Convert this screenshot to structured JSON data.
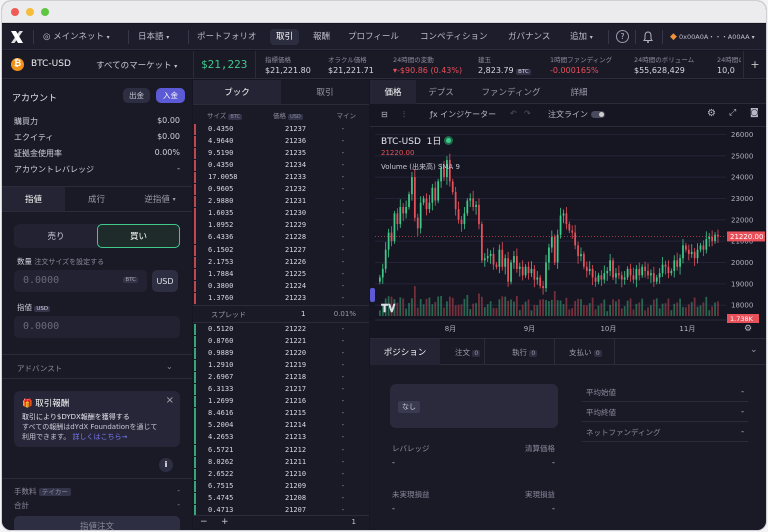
{
  "nav": {
    "network": "メインネット",
    "language": "日本語",
    "items": [
      "ポートフォリオ",
      "取引",
      "報酬",
      "プロフィール",
      "コンペティション",
      "ガバナンス",
      "追加"
    ],
    "address": "0x00A0A・・・A00AA"
  },
  "market": {
    "symbol": "BTC-USD",
    "all_markets": "すべてのマーケット",
    "price": "$21,223",
    "stats": [
      {
        "label": "指標価格",
        "value": "$21,221.80"
      },
      {
        "label": "オラクル価格",
        "value": "$21,221.71"
      },
      {
        "label": "24時間の変動",
        "value": "-$90.86 (0.43%)"
      },
      {
        "label": "建玉",
        "value": "2,823.79",
        "unit": "BTC"
      },
      {
        "label": "1時間ファンディング",
        "value": "-0.000165%"
      },
      {
        "label": "24時間のボリューム",
        "value": "$55,628,429"
      },
      {
        "label": "24時間の取引",
        "value": "10,0"
      }
    ]
  },
  "account": {
    "title": "アカウント",
    "withdraw": "出金",
    "deposit": "入金",
    "rows": [
      {
        "label": "購買力",
        "value": "$0.00"
      },
      {
        "label": "エクイティ",
        "value": "$0.00"
      },
      {
        "label": "証拠金使用率",
        "value": "0.00%"
      },
      {
        "label": "アカウントレバレッジ",
        "value": "-"
      }
    ]
  },
  "order": {
    "tabs": [
      "指値",
      "成行",
      "逆指値"
    ],
    "sell": "売り",
    "buy": "買い",
    "amount_label": "数量",
    "amount_hint": "注文サイズを設定する",
    "amount_placeholder": "0.0000",
    "amount_unit": "BTC",
    "usd": "USD",
    "limit_label": "指値",
    "limit_unit": "USD",
    "limit_placeholder": "0.0000",
    "advanced": "アドバンスト",
    "promo": {
      "title": "取引報酬",
      "line1": "取引により$DYDX報酬を獲得する",
      "line2": "すべての報酬はdYdX Foundationを通じて",
      "line3": "利用できます。",
      "link": "詳しくはこちら→"
    },
    "fee_label": "手数料",
    "fee_tag": "テイカー",
    "fee_value": "-",
    "total_label": "合計",
    "total_value": "-",
    "submit": "指値注文"
  },
  "book": {
    "tabs": [
      "ブック",
      "取引"
    ],
    "headers": [
      "サイズ",
      "価格",
      "マイン"
    ],
    "size_unit": "BTC",
    "price_unit": "USD",
    "asks": [
      [
        "0.4350",
        "21237",
        "-"
      ],
      [
        "4.9640",
        "21236",
        "-"
      ],
      [
        "9.5190",
        "21235",
        "-"
      ],
      [
        "0.4350",
        "21234",
        "-"
      ],
      [
        "17.0058",
        "21233",
        "-"
      ],
      [
        "0.9605",
        "21232",
        "-"
      ],
      [
        "2.9880",
        "21231",
        "-"
      ],
      [
        "1.6035",
        "21230",
        "-"
      ],
      [
        "1.0952",
        "21229",
        "-"
      ],
      [
        "6.4336",
        "21228",
        "-"
      ],
      [
        "6.1502",
        "21227",
        "-"
      ],
      [
        "2.1753",
        "21226",
        "-"
      ],
      [
        "1.7884",
        "21225",
        "-"
      ],
      [
        "0.3800",
        "21224",
        "-"
      ],
      [
        "1.3760",
        "21223",
        "-"
      ]
    ],
    "spread_label": "スプレッド",
    "spread_value": "1",
    "spread_pct": "0.01%",
    "bids": [
      [
        "0.5120",
        "21222",
        "-"
      ],
      [
        "0.8760",
        "21221",
        "-"
      ],
      [
        "0.9889",
        "21220",
        "-"
      ],
      [
        "1.2910",
        "21219",
        "-"
      ],
      [
        "2.6967",
        "21218",
        "-"
      ],
      [
        "6.3133",
        "21217",
        "-"
      ],
      [
        "1.2699",
        "21216",
        "-"
      ],
      [
        "8.4616",
        "21215",
        "-"
      ],
      [
        "5.2004",
        "21214",
        "-"
      ],
      [
        "4.2653",
        "21213",
        "-"
      ],
      [
        "6.5721",
        "21212",
        "-"
      ],
      [
        "8.0262",
        "21211",
        "-"
      ],
      [
        "2.6522",
        "21210",
        "-"
      ],
      [
        "6.7515",
        "21209",
        "-"
      ],
      [
        "5.4745",
        "21208",
        "-"
      ],
      [
        "0.4713",
        "21207",
        "-"
      ]
    ],
    "zoom_out": "−",
    "zoom_in": "+",
    "group": "1"
  },
  "chart_tabs": [
    "価格",
    "デプス",
    "ファンディング",
    "詳細"
  ],
  "chart_toolbar": {
    "indicators": "インジケーター",
    "order_lines": "注文ライン"
  },
  "chart_data": {
    "type": "candlestick",
    "symbol": "BTC-USD",
    "interval": "1日",
    "last_price": "21220.00",
    "volume_label": "Volume (出来高) SMA 9",
    "price_marker": "21220.00",
    "y_ticks": [
      26000,
      25000,
      24000,
      23000,
      22000,
      21000,
      20000,
      19000,
      18000
    ],
    "low_marker": "1.738K",
    "x_ticks": [
      "8月",
      "9月",
      "10月",
      "11月"
    ],
    "ylim": [
      17400,
      26300
    ],
    "closes": [
      19300,
      19700,
      20600,
      21400,
      21000,
      22300,
      21800,
      22600,
      22300,
      22600,
      23200,
      24000,
      22100,
      21600,
      22800,
      23000,
      22500,
      22800,
      23500,
      22900,
      23800,
      24400,
      24000,
      24800,
      23800,
      23300,
      22500,
      22000,
      21800,
      22300,
      22900,
      23000,
      22600,
      22700,
      21800,
      20100,
      20200,
      20300,
      20400,
      19900,
      19800,
      20600,
      19800,
      20200,
      19100,
      20000,
      20300,
      19700,
      19800,
      19400,
      19800,
      19500,
      19700,
      19200,
      19300,
      18900,
      18800,
      20000,
      20700,
      21200,
      20000,
      21300,
      22200,
      22300,
      21800,
      21500,
      21400,
      20800,
      20300,
      20400,
      19800,
      19600,
      19700,
      19300,
      19100,
      19400,
      19200,
      19500,
      19600,
      20100,
      19300,
      19500,
      19400,
      19200,
      19300,
      19700,
      19400,
      19200,
      19700,
      19400,
      19800,
      19600,
      19400,
      19500,
      19100,
      19300,
      19500,
      19900,
      19800,
      19500,
      19600,
      20100,
      19800,
      20200,
      20800,
      20600,
      20400,
      20500,
      20200,
      20600,
      20800,
      20600,
      21100,
      21200,
      21000,
      21300,
      21220
    ]
  },
  "positions": {
    "tabs": [
      {
        "label": "ポジション"
      },
      {
        "label": "注文",
        "count": "0"
      },
      {
        "label": "執行",
        "count": "0"
      },
      {
        "label": "支払い",
        "count": "0"
      }
    ],
    "none": "なし",
    "leverage": "レバレッジ",
    "liq_price": "清算価格",
    "unrealized": "未実現損益",
    "realized": "実現損益",
    "dash": "-",
    "avg_open": "平均始値",
    "avg_close": "平均終値",
    "net_funding": "ネットファンディング"
  }
}
